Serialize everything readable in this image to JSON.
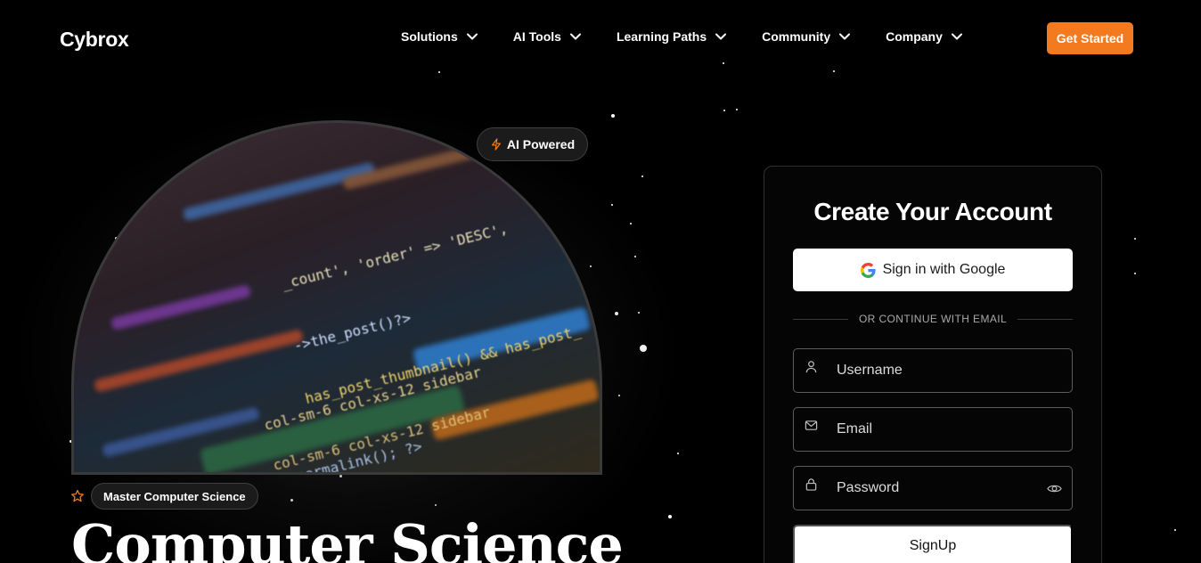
{
  "brand": {
    "name": "Cybrox",
    "accent": "#f47a1f"
  },
  "nav": {
    "items": [
      {
        "label": "Solutions",
        "icon": "chevron-down-icon"
      },
      {
        "label": "AI Tools",
        "icon": "chevron-down-icon"
      },
      {
        "label": "Learning Paths",
        "icon": "chevron-down-icon"
      },
      {
        "label": "Community",
        "icon": "chevron-down-icon"
      },
      {
        "label": "Company",
        "icon": "chevron-down-icon"
      }
    ],
    "cta_label": "Get Started"
  },
  "hero": {
    "badge_label": "AI Powered",
    "badge_icon": "lightning-icon",
    "tag_icon": "star-outline-icon",
    "tag_label": "Master Computer Science",
    "title": "Computer Science",
    "image_code_lines": [
      "_count', 'order' => 'DESC',",
      "->the_post()?>",
      "has_post_thumbnail() && has_post_",
      "col-sm-6 col-xs-12 sidebar",
      "col-sm-6 col-xs-12 sidebar",
      "the_permalink(); ?>"
    ]
  },
  "signup_form": {
    "title": "Create Your Account",
    "google_label": "Sign in with Google",
    "divider_text": "OR CONTINUE WITH EMAIL",
    "username_placeholder": "Username",
    "email_placeholder": "Email",
    "password_placeholder": "Password",
    "submit_label": "SignUp"
  }
}
